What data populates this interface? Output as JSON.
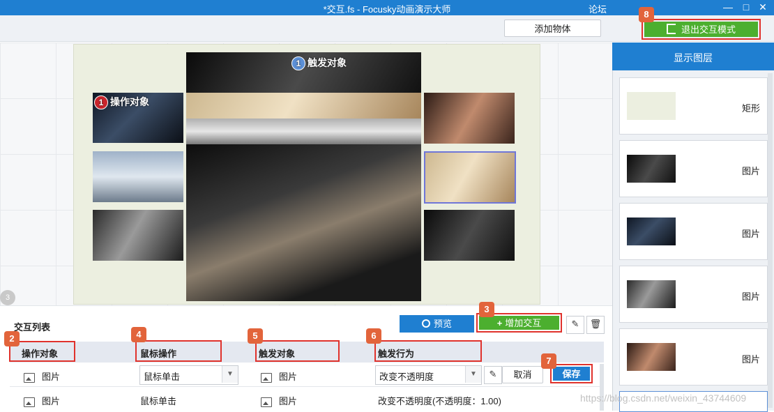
{
  "window": {
    "title": "*交互.fs - Focusky动画演示大师",
    "forum": "论坛",
    "min": "—",
    "max": "□",
    "close": "✕"
  },
  "toolbar": {
    "add_object": "添加物体",
    "exit_mode": "退出交互模式",
    "exit_badge": "8"
  },
  "canvas": {
    "circle1": "1",
    "circle3": "3",
    "operate_num": "1",
    "operate_label": "操作对象",
    "trigger_num": "1",
    "trigger_label": "触发对象"
  },
  "layers": {
    "header": "显示图层",
    "items": [
      {
        "label": "矩形"
      },
      {
        "label": "图片"
      },
      {
        "label": "图片"
      },
      {
        "label": "图片"
      },
      {
        "label": "图片"
      }
    ]
  },
  "interaction": {
    "list_title": "交互列表",
    "preview": "预览",
    "add": "增加交互",
    "badges": {
      "b2": "2",
      "b3": "3",
      "b4": "4",
      "b5": "5",
      "b6": "6",
      "b7": "7"
    },
    "columns": [
      "操作对象",
      "鼠标操作",
      "触发对象",
      "触发行为"
    ],
    "edit_row": {
      "operate": "图片",
      "mouse": "鼠标单击",
      "trigger": "图片",
      "behavior": "改变不透明度",
      "cancel": "取消",
      "save": "保存"
    },
    "row2": {
      "operate": "图片",
      "mouse": "鼠标单击",
      "trigger": "图片",
      "behavior": "改变不透明度(不透明度：1.00)"
    }
  },
  "watermark": "https://blog.csdn.net/weixin_43744609",
  "colors": {
    "title_blue": "#1f7fd1",
    "green": "#4caf2f",
    "red_box": "#e0322c",
    "badge": "#e2643b"
  }
}
